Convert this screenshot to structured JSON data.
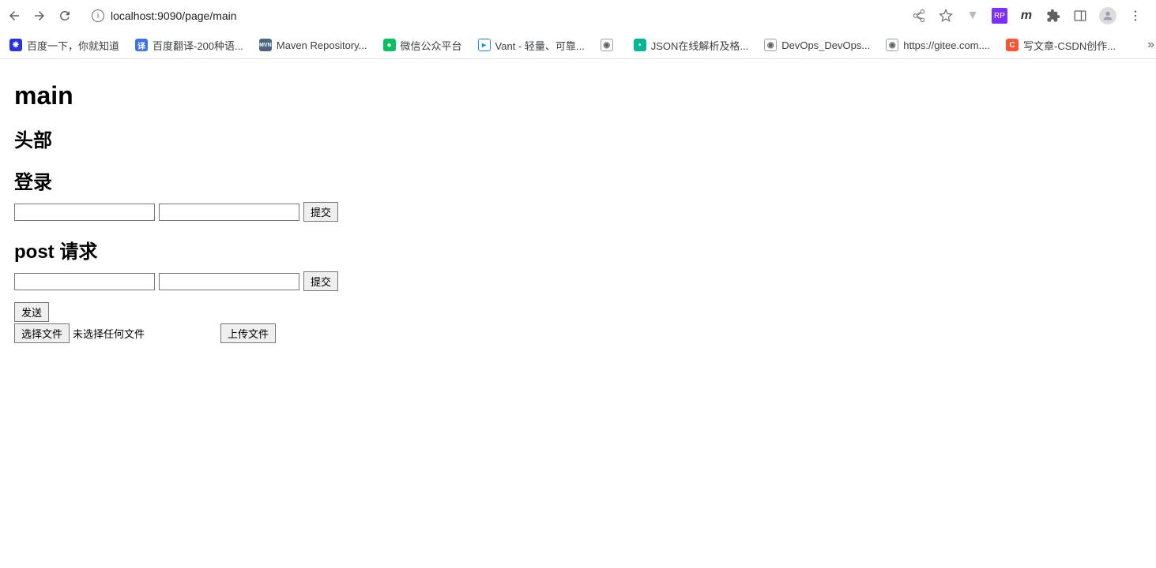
{
  "toolbar": {
    "url": "localhost:9090/page/main"
  },
  "bookmarks": [
    {
      "label": "百度一下，你就知道",
      "iconColor": "#2932e1",
      "iconText": "❋"
    },
    {
      "label": "百度翻译-200种语...",
      "iconColor": "#3b72f0",
      "iconText": "译"
    },
    {
      "label": "Maven Repository...",
      "iconColor": "#4b6584",
      "iconText": "MVN"
    },
    {
      "label": "微信公众平台",
      "iconColor": "#07c160",
      "iconText": "●"
    },
    {
      "label": "Vant - 轻量、可靠...",
      "iconColor": "#1989fa",
      "iconText": "▸"
    },
    {
      "label": "",
      "iconColor": "#5f6368",
      "iconText": "◉"
    },
    {
      "label": "JSON在线解析及格...",
      "iconColor": "#00b894",
      "iconText": "••"
    },
    {
      "label": "DevOps_DevOps...",
      "iconColor": "#5f6368",
      "iconText": "◉"
    },
    {
      "label": "https://gitee.com....",
      "iconColor": "#5f6368",
      "iconText": "◉"
    },
    {
      "label": "写文章-CSDN创作...",
      "iconColor": "#fc5531",
      "iconText": "C"
    }
  ],
  "page": {
    "h1": "main",
    "h2_header": "头部",
    "h2_login": "登录",
    "submit1": "提交",
    "h2_post": "post 请求",
    "submit2": "提交",
    "send": "发送",
    "choose_file": "选择文件",
    "no_file": "未选择任何文件",
    "upload": "上传文件"
  }
}
